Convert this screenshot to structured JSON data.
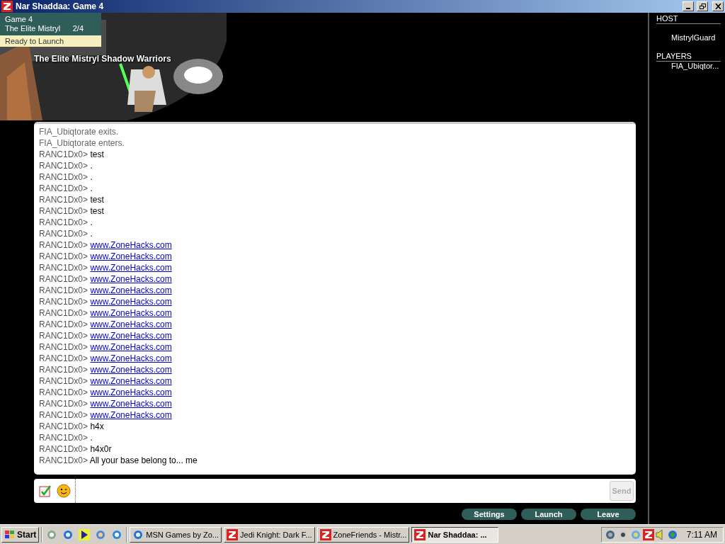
{
  "window": {
    "title": "Nar Shaddaa: Game 4"
  },
  "game_info": {
    "game": "Game 4",
    "team": "The Elite Mistryl",
    "count": "2/4",
    "status": "Ready to Launch"
  },
  "banner": {
    "title": "The Elite Mistryl Shadow Warriors"
  },
  "chat": [
    {
      "kind": "system",
      "text": "FIA_Ubiqtorate exits."
    },
    {
      "kind": "system",
      "text": "FIA_Ubiqtorate enters."
    },
    {
      "kind": "chat",
      "user": "RANC1Dx0>",
      "text": "test"
    },
    {
      "kind": "chat",
      "user": "RANC1Dx0>",
      "text": "."
    },
    {
      "kind": "chat",
      "user": "RANC1Dx0>",
      "text": "."
    },
    {
      "kind": "chat",
      "user": "RANC1Dx0>",
      "text": "."
    },
    {
      "kind": "chat",
      "user": "RANC1Dx0>",
      "text": "test"
    },
    {
      "kind": "chat",
      "user": "RANC1Dx0>",
      "text": "test"
    },
    {
      "kind": "chat",
      "user": "RANC1Dx0>",
      "text": "."
    },
    {
      "kind": "chat",
      "user": "RANC1Dx0>",
      "text": "."
    },
    {
      "kind": "link",
      "user": "RANC1Dx0>",
      "text": "www.ZoneHacks.com"
    },
    {
      "kind": "link",
      "user": "RANC1Dx0>",
      "text": "www.ZoneHacks.com"
    },
    {
      "kind": "link",
      "user": "RANC1Dx0>",
      "text": "www.ZoneHacks.com"
    },
    {
      "kind": "link",
      "user": "RANC1Dx0>",
      "text": "www.ZoneHacks.com"
    },
    {
      "kind": "link",
      "user": "RANC1Dx0>",
      "text": "www.ZoneHacks.com"
    },
    {
      "kind": "link",
      "user": "RANC1Dx0>",
      "text": "www.ZoneHacks.com"
    },
    {
      "kind": "link",
      "user": "RANC1Dx0>",
      "text": "www.ZoneHacks.com"
    },
    {
      "kind": "link",
      "user": "RANC1Dx0>",
      "text": "www.ZoneHacks.com"
    },
    {
      "kind": "link",
      "user": "RANC1Dx0>",
      "text": "www.ZoneHacks.com"
    },
    {
      "kind": "link",
      "user": "RANC1Dx0>",
      "text": "www.ZoneHacks.com"
    },
    {
      "kind": "link",
      "user": "RANC1Dx0>",
      "text": "www.ZoneHacks.com"
    },
    {
      "kind": "link",
      "user": "RANC1Dx0>",
      "text": "www.ZoneHacks.com"
    },
    {
      "kind": "link",
      "user": "RANC1Dx0>",
      "text": "www.ZoneHacks.com"
    },
    {
      "kind": "link",
      "user": "RANC1Dx0>",
      "text": "www.ZoneHacks.com"
    },
    {
      "kind": "link",
      "user": "RANC1Dx0>",
      "text": "www.ZoneHacks.com"
    },
    {
      "kind": "link",
      "user": "RANC1Dx0>",
      "text": "www.ZoneHacks.com"
    },
    {
      "kind": "chat",
      "user": "RANC1Dx0>",
      "text": "h4x"
    },
    {
      "kind": "chat",
      "user": "RANC1Dx0>",
      "text": "."
    },
    {
      "kind": "chat",
      "user": "RANC1Dx0>",
      "text": "h4x0r"
    },
    {
      "kind": "chat",
      "user": "RANC1Dx0>",
      "text": "All your base belong to... me"
    }
  ],
  "input": {
    "send": "Send",
    "send_disabled": true
  },
  "actions": [
    "Settings",
    "Launch",
    "Leave"
  ],
  "host": {
    "label": "HOST",
    "name": "MistrylGuard"
  },
  "players": {
    "label": "PLAYERS",
    "names": [
      "FIA_Ubiqtor..."
    ]
  },
  "taskbar": {
    "start": "Start",
    "tasks": [
      {
        "label": "MSN Games by Zo...",
        "selected": false
      },
      {
        "label": "Jedi Knight: Dark F...",
        "selected": false
      },
      {
        "label": "ZoneFriends - Mistr...",
        "selected": false
      },
      {
        "label": "Nar Shaddaa: ...",
        "selected": true
      }
    ],
    "clock": "7:11 AM"
  }
}
